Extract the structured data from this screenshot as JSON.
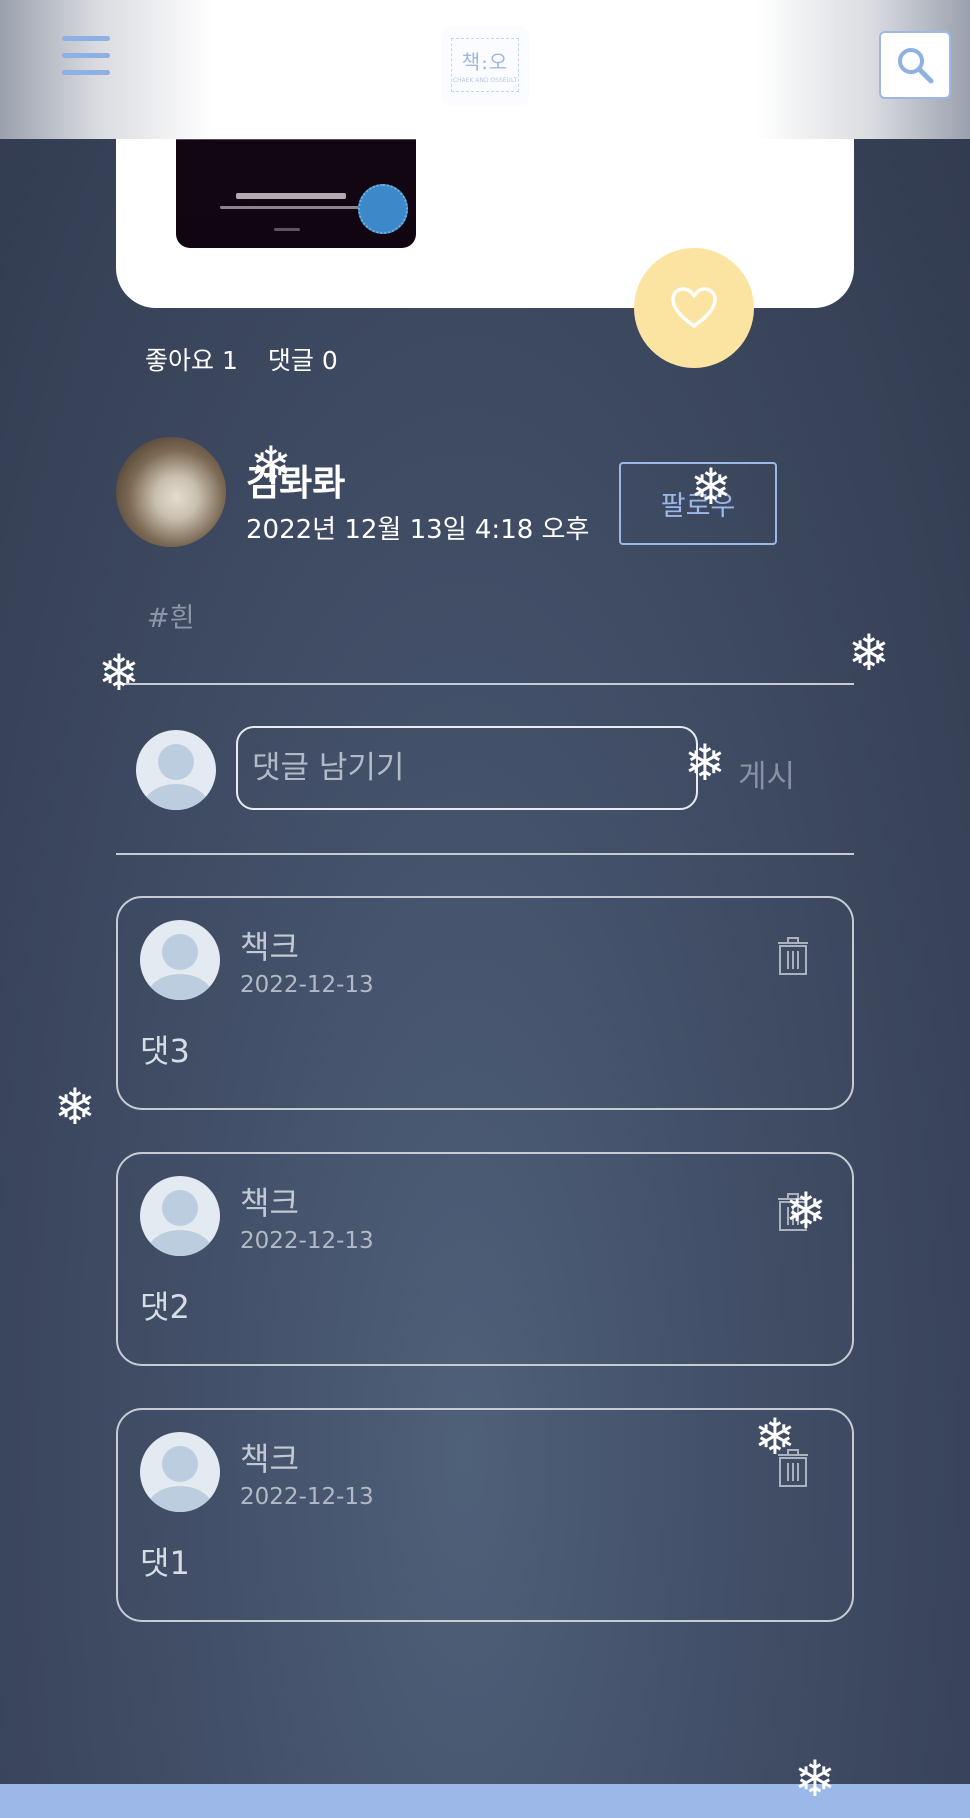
{
  "header": {
    "logo_text": "책:오",
    "logo_subtext": "CHAEK AND OSSEULT",
    "menu_icon": "hamburger-menu-icon",
    "search_icon": "search-icon",
    "accent_color": "#9cb8e8"
  },
  "post": {
    "like_icon": "heart-icon",
    "like_button_color": "#fbe3a2",
    "like_label": "좋아요",
    "like_count": "1",
    "comment_label": "댓글",
    "comment_count": "0",
    "author_name": "검롸롸",
    "date": "2022년 12월 13일 4:18 오후",
    "follow_label": "팔로우",
    "tag": "#흰"
  },
  "comment_form": {
    "placeholder": "댓글 남기기",
    "submit_label": "게시"
  },
  "comments": [
    {
      "author": "책크",
      "date": "2022-12-13",
      "text": "댓3"
    },
    {
      "author": "책크",
      "date": "2022-12-13",
      "text": "댓2"
    },
    {
      "author": "책크",
      "date": "2022-12-13",
      "text": "댓1"
    }
  ],
  "decoration": {
    "flake_glyph": "❄"
  }
}
